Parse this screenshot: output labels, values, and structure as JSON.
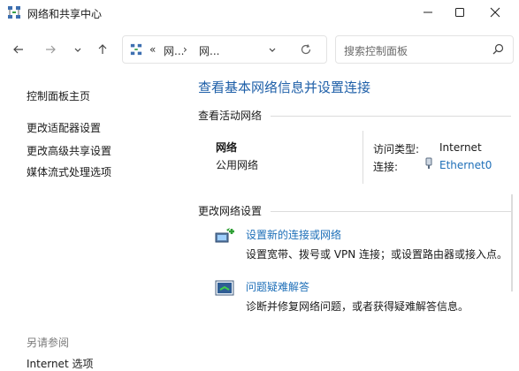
{
  "window": {
    "title": "网络和共享中心"
  },
  "nav": {
    "address_parts": [
      "«",
      "网...",
      "›",
      "网..."
    ],
    "search_placeholder": "搜索控制面板"
  },
  "sidebar": {
    "items": [
      {
        "label": "控制面板主页"
      },
      {
        "label": "更改适配器设置"
      },
      {
        "label": "更改高级共享设置"
      },
      {
        "label": "媒体流式处理选项"
      }
    ],
    "see_also_heading": "另请参阅",
    "see_also_items": [
      {
        "label": "Internet 选项"
      }
    ]
  },
  "main": {
    "title": "查看基本网络信息并设置连接",
    "active_section": "查看活动网络",
    "network": {
      "name": "网络",
      "type": "公用网络",
      "access_label": "访问类型:",
      "access_value": "Internet",
      "conn_label": "连接:",
      "conn_value": "Ethernet0"
    },
    "change_section": "更改网络设置",
    "tasks": [
      {
        "link": "设置新的连接或网络",
        "desc": "设置宽带、拨号或 VPN 连接；或设置路由器或接入点。"
      },
      {
        "link": "问题疑难解答",
        "desc": "诊断并修复网络问题，或者获得疑难解答信息。"
      }
    ]
  },
  "colors": {
    "link": "#1e6fb8",
    "title": "#1e5fa8"
  }
}
